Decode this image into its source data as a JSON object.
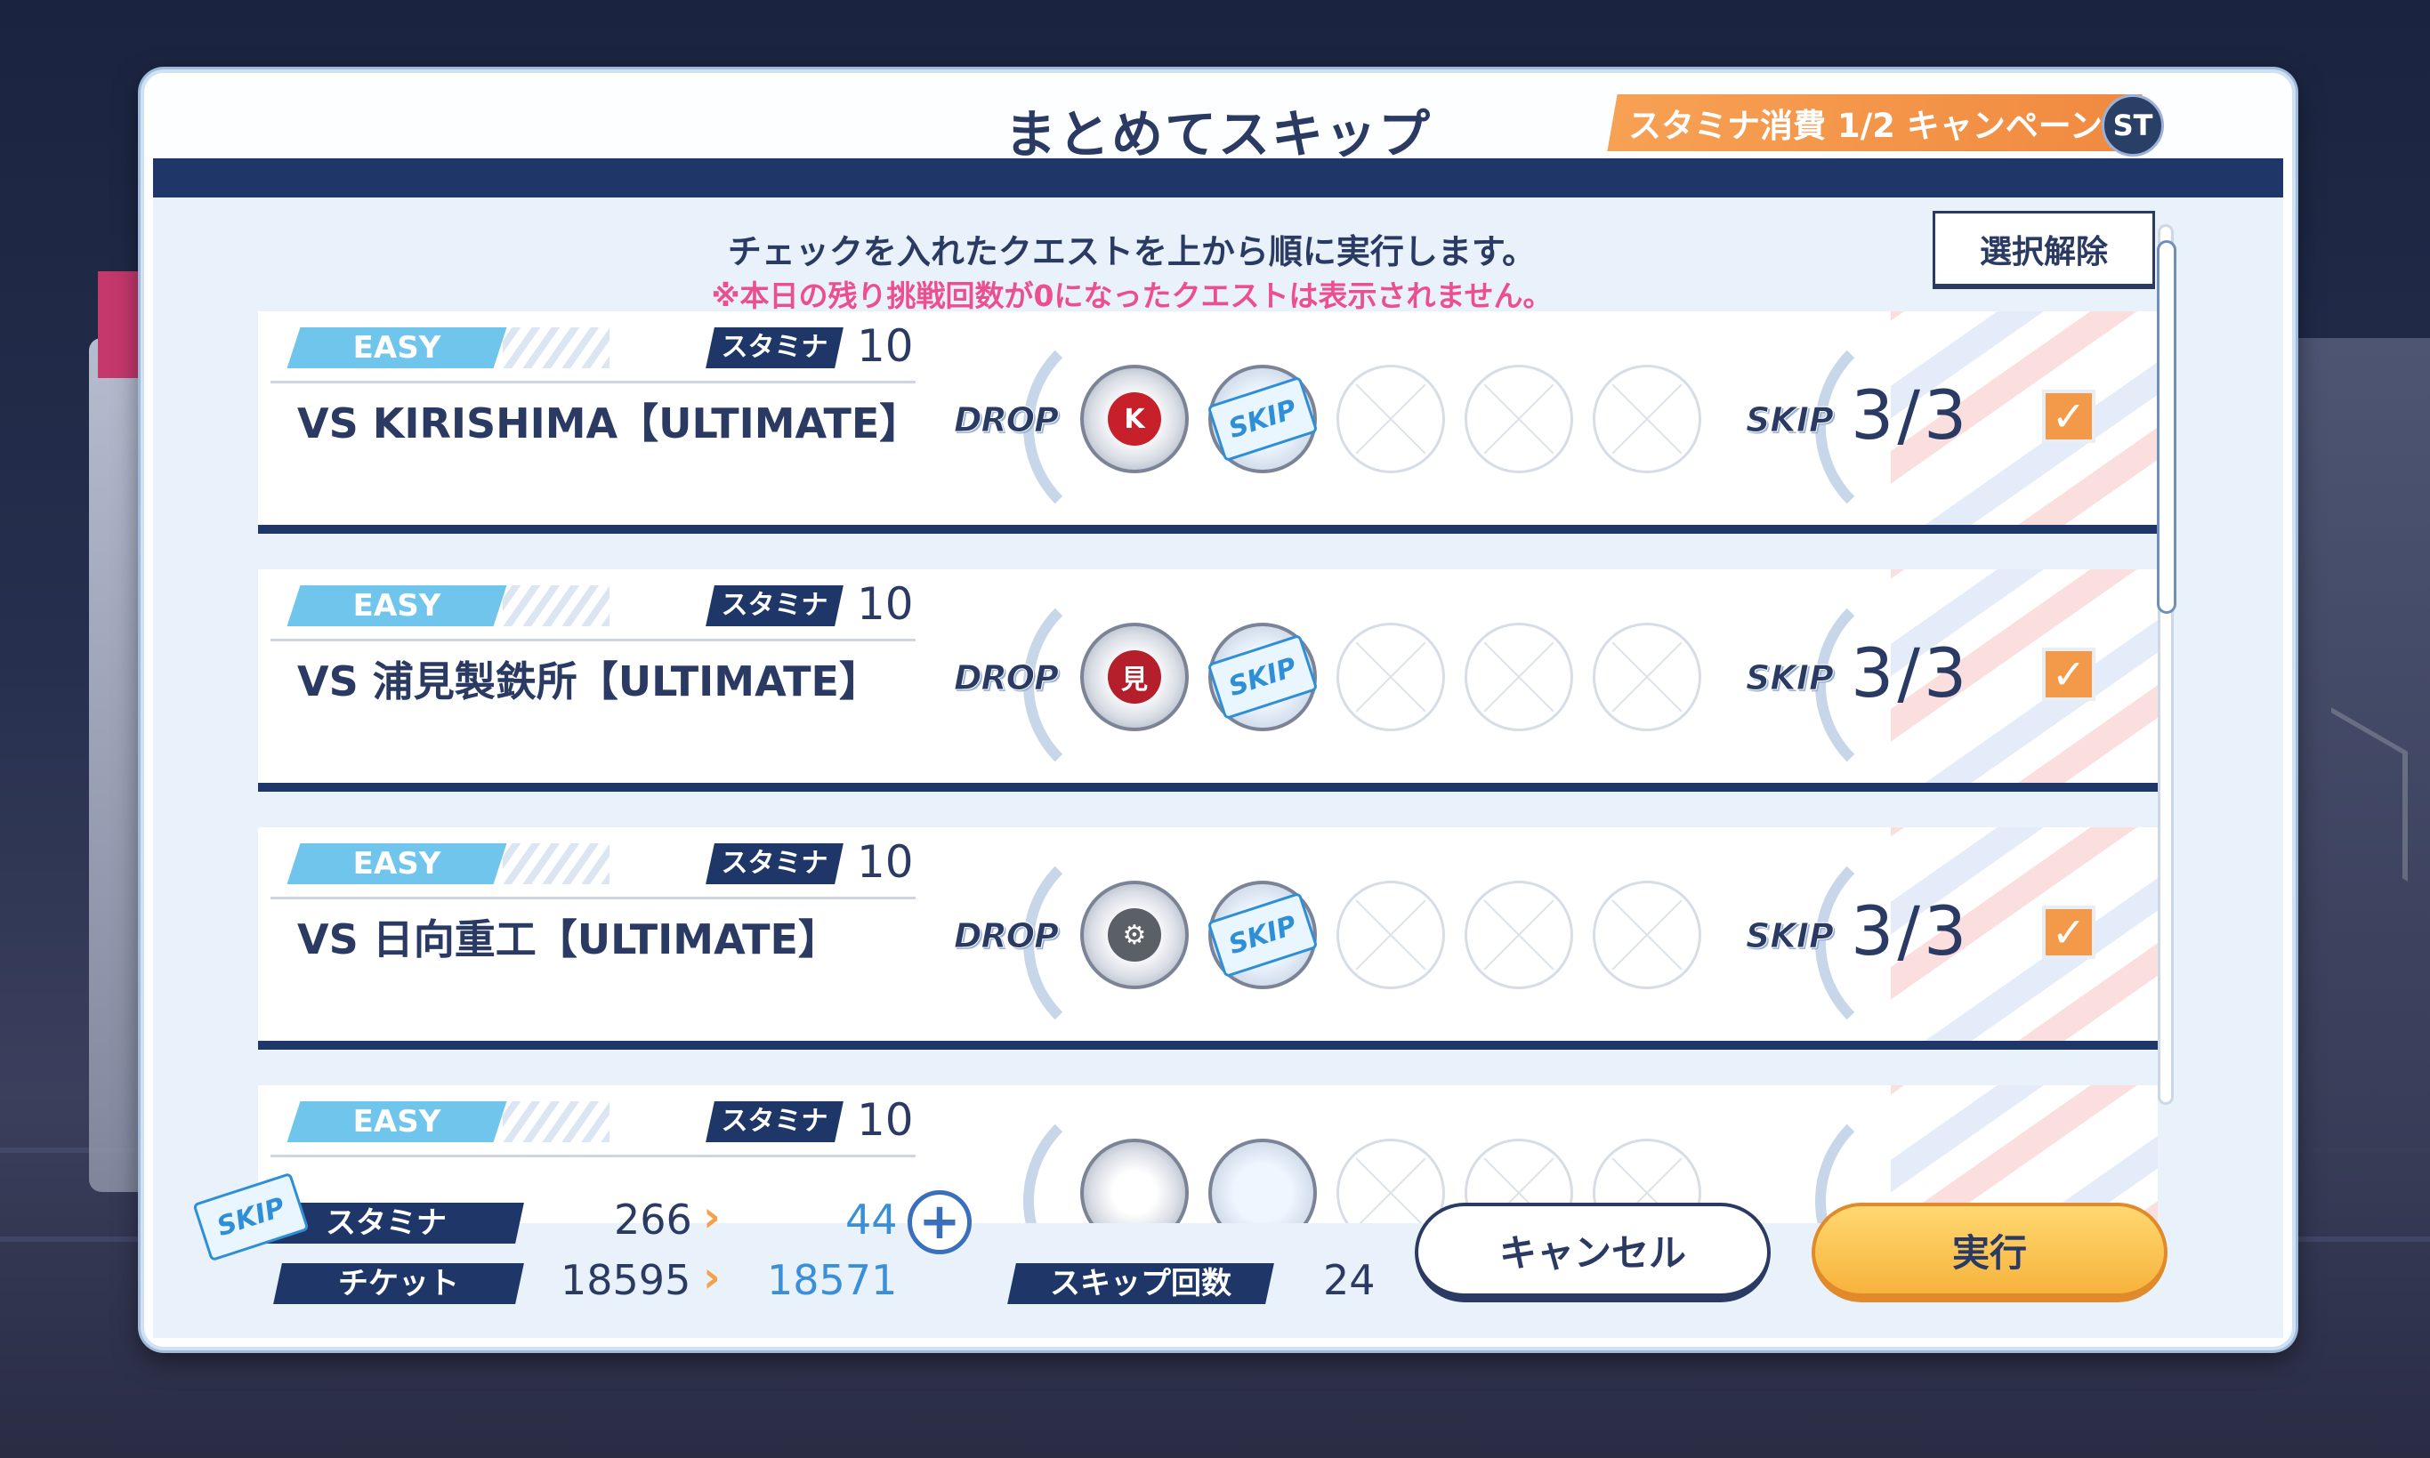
{
  "dialog": {
    "title": "まとめてスキップ",
    "campaign": "スタミナ消費 1/2 キャンペーン",
    "campaign_badge": "ST",
    "instruction": "チェックを入れたクエストを上から順に実行します。",
    "warning": "※本日の残り挑戦回数が0になったクエストは表示されません。",
    "deselect_label": "選択解除"
  },
  "row_labels": {
    "difficulty": "EASY",
    "stamina": "スタミナ",
    "drop": "DROP",
    "skip": "SKIP",
    "ticket_text": "SKIP"
  },
  "quests": [
    {
      "difficulty": "EASY",
      "stamina": "10",
      "name": "VS KIRISHIMA【ULTIMATE】",
      "emblem": "kirishima-emblem-icon",
      "emblem_color": "#c8202a",
      "skip_count": "3/3",
      "checked": true
    },
    {
      "difficulty": "EASY",
      "stamina": "10",
      "name": "VS 浦見製鉄所【ULTIMATE】",
      "emblem": "urami-emblem-icon",
      "emblem_color": "#b51f2c",
      "skip_count": "3/3",
      "checked": true
    },
    {
      "difficulty": "EASY",
      "stamina": "10",
      "name": "VS 日向重工【ULTIMATE】",
      "emblem": "hyuga-emblem-icon",
      "emblem_color": "#5b5f66",
      "skip_count": "3/3",
      "checked": true
    },
    {
      "difficulty": "EASY",
      "stamina": "10",
      "name": "",
      "emblem": "",
      "skip_count": "",
      "checked": true
    }
  ],
  "footer": {
    "stamina_label": "スタミナ",
    "stamina_before": "266",
    "stamina_after": "44",
    "ticket_label": "チケット",
    "ticket_before": "18595",
    "ticket_after": "18571",
    "skip_count_label": "スキップ回数",
    "skip_count": "24",
    "cancel_label": "キャンセル",
    "execute_label": "実行"
  },
  "colors": {
    "navy": "#1e3768",
    "accent_orange": "#f39a4a",
    "easy_blue": "#6fc5ec",
    "warn_pink": "#ec4f90",
    "exec_yellow": "#f7b33d"
  }
}
